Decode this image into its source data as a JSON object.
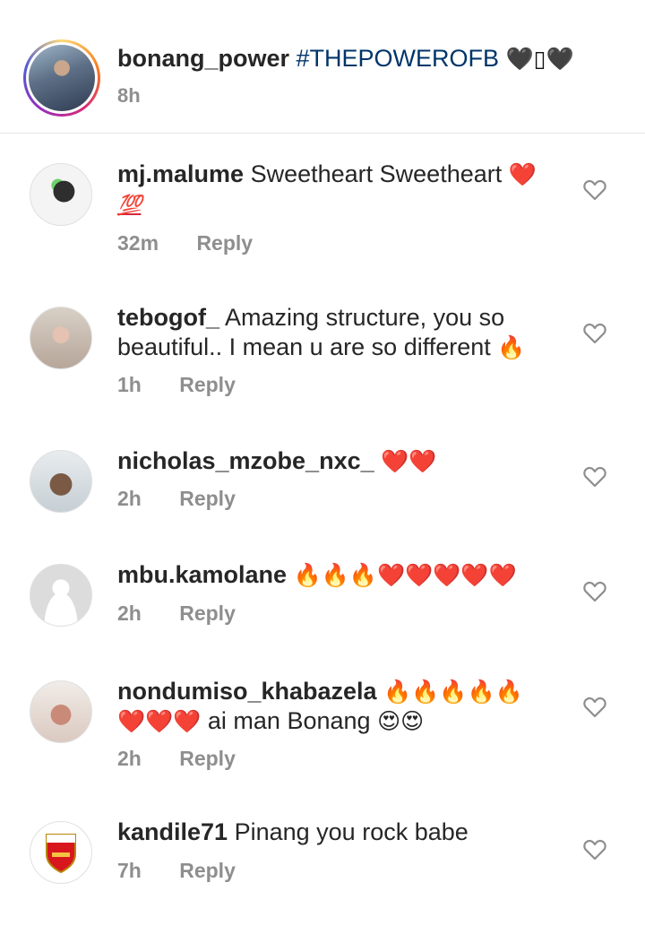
{
  "caption": {
    "username": "bonang_power",
    "hashtag": "#THEPOWEROFB",
    "emojis": "🖤▯🖤",
    "time": "8h"
  },
  "comments": [
    {
      "username": "mj.malume",
      "text": "Sweetheart Sweetheart",
      "emoji_end": "❤️",
      "emoji_line2": "💯",
      "time": "32m",
      "reply": "Reply"
    },
    {
      "username": "tebogof_",
      "text": "Amazing structure, you so beautiful.. I mean u are so different",
      "emoji_end": "🔥",
      "time": "1h",
      "reply": "Reply"
    },
    {
      "username": "nicholas_mzobe_nxc_",
      "text": "",
      "emoji_end": "❤️❤️",
      "time": "2h",
      "reply": "Reply"
    },
    {
      "username": "mbu.kamolane",
      "text": "",
      "emoji_end": "🔥🔥🔥❤️❤️❤️❤️❤️",
      "time": "2h",
      "reply": "Reply"
    },
    {
      "username": "nondumiso_khabazela",
      "text": "",
      "emoji_end": "🔥🔥🔥🔥🔥",
      "emoji_line2": "❤️❤️❤️",
      "text_line2": "ai man Bonang",
      "emoji_line2_end": "😍😍",
      "time": "2h",
      "reply": "Reply"
    },
    {
      "username": "kandile71",
      "text": "Pinang you rock babe",
      "emoji_end": "",
      "time": "7h",
      "reply": "Reply"
    }
  ],
  "icons": {
    "like": "heart-outline-icon"
  },
  "colors": {
    "username": "#262626",
    "hashtag": "#003569",
    "meta": "#8e8e8e",
    "divider": "#e6e6e6"
  }
}
